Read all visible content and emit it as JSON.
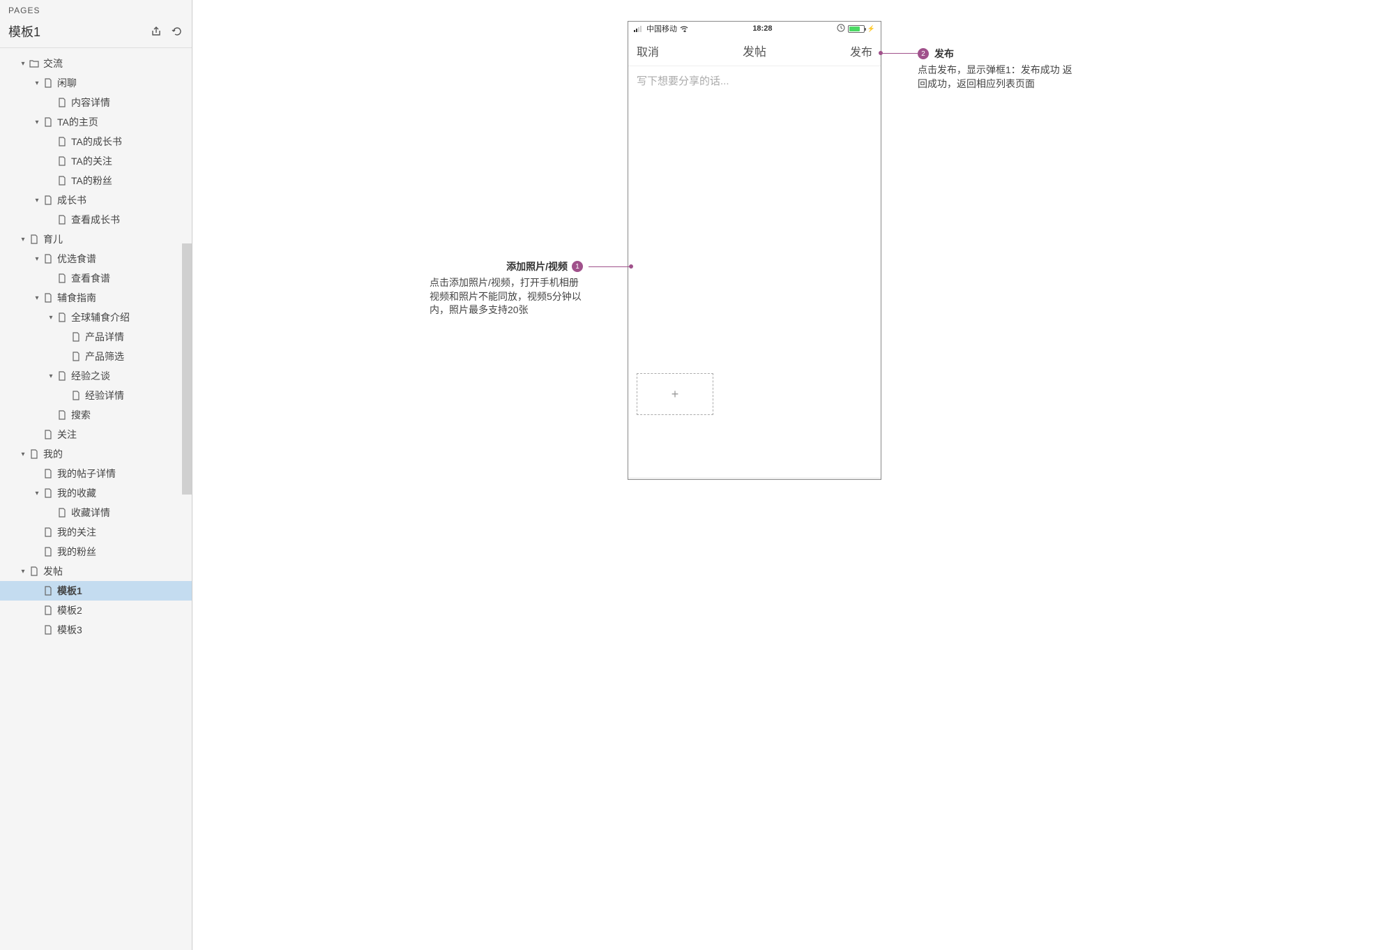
{
  "sidebar": {
    "header": "PAGES",
    "title": "模板1",
    "tree": [
      {
        "depth": 0,
        "chevron": true,
        "icon": "folder",
        "label": "交流"
      },
      {
        "depth": 1,
        "chevron": true,
        "icon": "page",
        "label": "闲聊"
      },
      {
        "depth": 2,
        "chevron": false,
        "icon": "page",
        "label": "内容详情"
      },
      {
        "depth": 1,
        "chevron": true,
        "icon": "page",
        "label": "TA的主页"
      },
      {
        "depth": 2,
        "chevron": false,
        "icon": "page",
        "label": "TA的成长书"
      },
      {
        "depth": 2,
        "chevron": false,
        "icon": "page",
        "label": "TA的关注"
      },
      {
        "depth": 2,
        "chevron": false,
        "icon": "page",
        "label": "TA的粉丝"
      },
      {
        "depth": 1,
        "chevron": true,
        "icon": "page",
        "label": "成长书"
      },
      {
        "depth": 2,
        "chevron": false,
        "icon": "page",
        "label": "查看成长书"
      },
      {
        "depth": 0,
        "chevron": true,
        "icon": "page",
        "label": "育儿"
      },
      {
        "depth": 1,
        "chevron": true,
        "icon": "page",
        "label": "优选食谱"
      },
      {
        "depth": 2,
        "chevron": false,
        "icon": "page",
        "label": "查看食谱"
      },
      {
        "depth": 1,
        "chevron": true,
        "icon": "page",
        "label": "辅食指南"
      },
      {
        "depth": 2,
        "chevron": true,
        "icon": "page",
        "label": "全球辅食介绍"
      },
      {
        "depth": 3,
        "chevron": false,
        "icon": "page",
        "label": "产品详情"
      },
      {
        "depth": 3,
        "chevron": false,
        "icon": "page",
        "label": "产品筛选"
      },
      {
        "depth": 2,
        "chevron": true,
        "icon": "page",
        "label": "经验之谈"
      },
      {
        "depth": 3,
        "chevron": false,
        "icon": "page",
        "label": "经验详情"
      },
      {
        "depth": 2,
        "chevron": false,
        "icon": "page",
        "label": "搜索"
      },
      {
        "depth": 1,
        "chevron": false,
        "icon": "page",
        "label": "关注"
      },
      {
        "depth": 0,
        "chevron": true,
        "icon": "page",
        "label": "我的"
      },
      {
        "depth": 1,
        "chevron": false,
        "icon": "page",
        "label": "我的帖子详情"
      },
      {
        "depth": 1,
        "chevron": true,
        "icon": "page",
        "label": "我的收藏"
      },
      {
        "depth": 2,
        "chevron": false,
        "icon": "page",
        "label": "收藏详情"
      },
      {
        "depth": 1,
        "chevron": false,
        "icon": "page",
        "label": "我的关注"
      },
      {
        "depth": 1,
        "chevron": false,
        "icon": "page",
        "label": "我的粉丝"
      },
      {
        "depth": 0,
        "chevron": true,
        "icon": "page",
        "label": "发帖"
      },
      {
        "depth": 1,
        "chevron": false,
        "icon": "page",
        "label": "模板1",
        "selected": true
      },
      {
        "depth": 1,
        "chevron": false,
        "icon": "page",
        "label": "模板2"
      },
      {
        "depth": 1,
        "chevron": false,
        "icon": "page",
        "label": "模板3"
      }
    ]
  },
  "phone": {
    "statusbar": {
      "carrier": "中国移动",
      "time": "18:28"
    },
    "nav": {
      "cancel": "取消",
      "title": "发帖",
      "publish": "发布"
    },
    "placeholder": "写下想要分享的话...",
    "add_media_plus": "+"
  },
  "annotations": {
    "a1": {
      "num": "1",
      "title": "添加照片/视频",
      "body": "点击添加照片/视频，打开手机相册 视频和照片不能同放，视频5分钟以内，照片最多支持20张"
    },
    "a2": {
      "num": "2",
      "title": "发布",
      "body": "点击发布，显示弹框1：发布成功 返回成功，返回相应列表页面"
    }
  }
}
